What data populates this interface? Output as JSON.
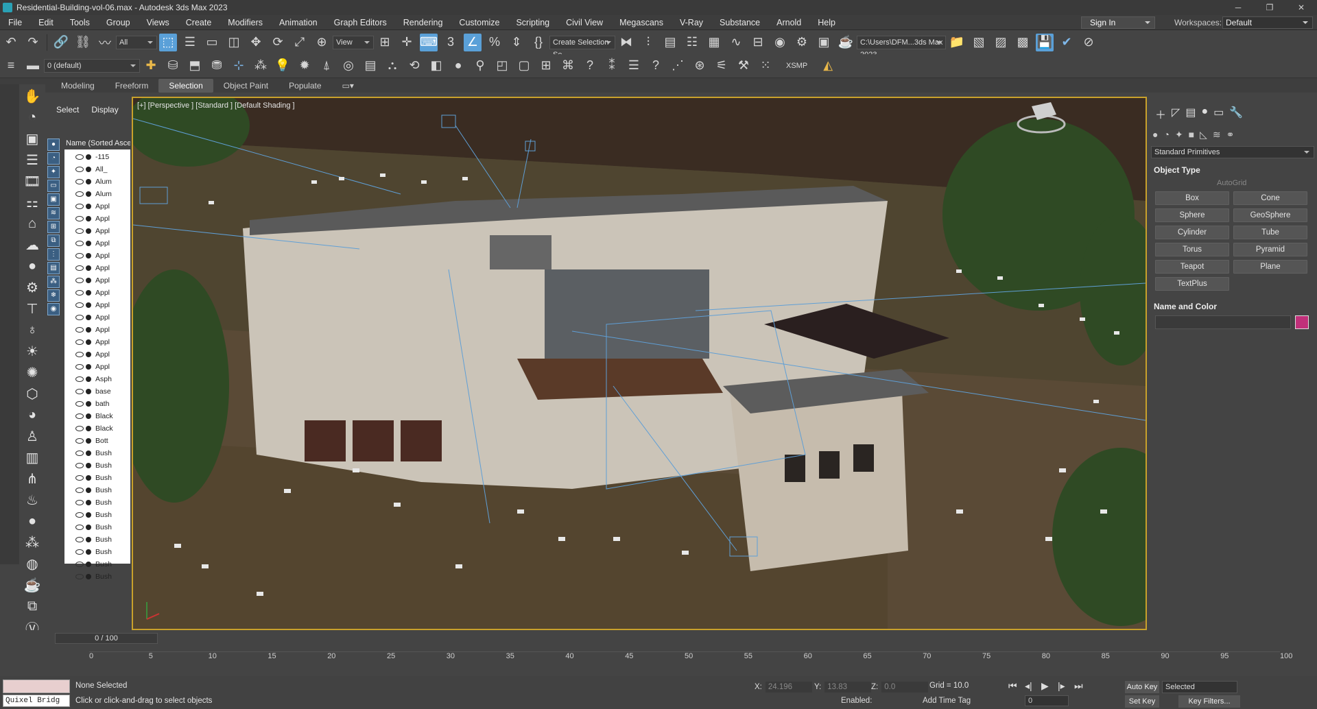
{
  "title": {
    "text": "Residential-Building-vol-06.max - Autodesk 3ds Max 2023"
  },
  "menu": [
    "File",
    "Edit",
    "Tools",
    "Group",
    "Views",
    "Create",
    "Modifiers",
    "Animation",
    "Graph Editors",
    "Rendering",
    "Customize",
    "Scripting",
    "Civil View",
    "Megascans",
    "V-Ray",
    "Substance",
    "Arnold",
    "Help"
  ],
  "signin": "Sign In",
  "workspaces": {
    "label": "Workspaces:",
    "value": "Default"
  },
  "toolbar": {
    "filter": "All",
    "refcoord": "View",
    "selset": "Create Selection Se",
    "path": "C:\\Users\\DFM...3ds Max 2023",
    "layer": "0 (default)",
    "xsmp": "XSMP"
  },
  "ribbon": {
    "tabs": [
      "Modeling",
      "Freeform",
      "Selection",
      "Object Paint",
      "Populate"
    ],
    "active": "Selection"
  },
  "scene": {
    "tabs": [
      "Select",
      "Display"
    ],
    "header": "Name (Sorted Asce",
    "rows": [
      "-115",
      "All_",
      "Alum",
      "Alum",
      "Appl",
      "Appl",
      "Appl",
      "Appl",
      "Appl",
      "Appl",
      "Appl",
      "Appl",
      "Appl",
      "Appl",
      "Appl",
      "Appl",
      "Appl",
      "Appl",
      "Asph",
      "base",
      "bath",
      "Black",
      "Black",
      "Bott",
      "Bush",
      "Bush",
      "Bush",
      "Bush",
      "Bush",
      "Bush",
      "Bush",
      "Bush",
      "Bush",
      "Bush",
      "Bush"
    ]
  },
  "viewport": {
    "label": "[+] [Perspective ] [Standard ] [Default Shading ]"
  },
  "panel": {
    "category": "Standard Primitives",
    "object_type": "Object Type",
    "autogrid": "AutoGrid",
    "buttons": [
      "Box",
      "Cone",
      "Sphere",
      "GeoSphere",
      "Cylinder",
      "Tube",
      "Torus",
      "Pyramid",
      "Teapot",
      "Plane",
      "TextPlus"
    ],
    "name_color": "Name and Color",
    "swatch": "#c0307a"
  },
  "time": {
    "slider": "0 / 100",
    "ticks": [
      "0",
      "5",
      "10",
      "15",
      "20",
      "25",
      "30",
      "35",
      "40",
      "45",
      "50",
      "55",
      "60",
      "65",
      "70",
      "75",
      "80",
      "85",
      "90",
      "95",
      "100"
    ]
  },
  "status": {
    "script_listener": "Quixel Bridg",
    "none_selected": "None Selected",
    "prompt": "Click or click-and-drag to select objects",
    "x_label": "X:",
    "x": "24.196",
    "y_label": "Y:",
    "y": "13.83",
    "z_label": "Z:",
    "z": "0.0",
    "grid": "Grid = 10.0",
    "enabled": "Enabled:",
    "add_time_tag": "Add Time Tag",
    "auto_key": "Auto Key",
    "selected": "Selected",
    "set_key": "Set Key",
    "key_filters": "Key Filters...",
    "frame": "0"
  }
}
